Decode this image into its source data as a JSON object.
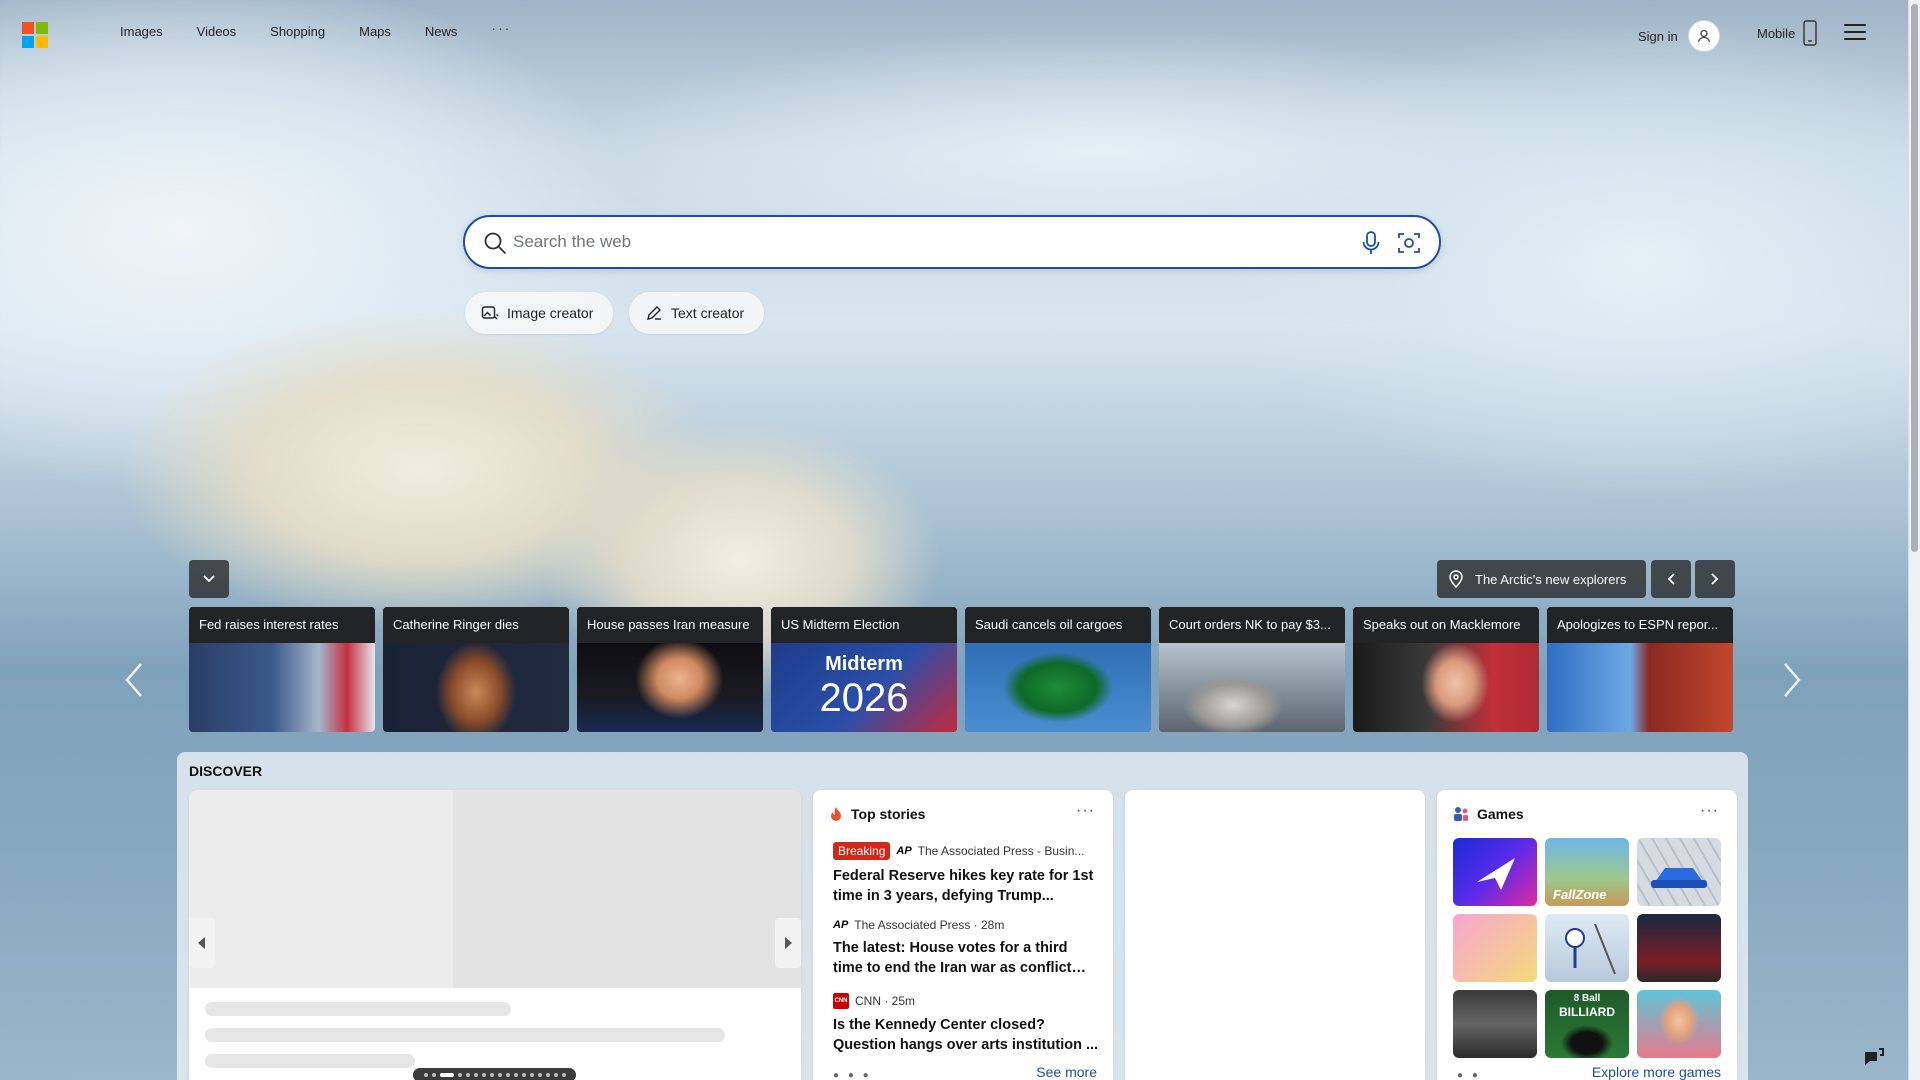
{
  "nav": {
    "items": [
      "Images",
      "Videos",
      "Shopping",
      "Maps",
      "News"
    ],
    "more": "···",
    "signin": "Sign in",
    "mobile": "Mobile"
  },
  "brand_colors": {
    "red": "#f25022",
    "green": "#7fba00",
    "blue": "#00a4ef",
    "yellow": "#ffb900",
    "accent": "#1a4fa3"
  },
  "search": {
    "placeholder": "Search the web",
    "value": ""
  },
  "actions": {
    "image_creator": "Image creator",
    "text_creator": "Text creator"
  },
  "image_info": {
    "title": "The Arctic's new explorers"
  },
  "trending": [
    {
      "title": "Fed raises interest rates"
    },
    {
      "title": "Catherine Ringer dies"
    },
    {
      "title": "House passes Iran measure"
    },
    {
      "title": "US Midterm Election",
      "overlay_line1": "Midterm",
      "overlay_line2": "2026"
    },
    {
      "title": "Saudi cancels oil cargoes"
    },
    {
      "title": "Court orders NK to pay $3..."
    },
    {
      "title": "Speaks out on Macklemore"
    },
    {
      "title": "Apologizes to ESPN repor..."
    }
  ],
  "discover": {
    "heading": "DISCOVER",
    "top_stories": {
      "title": "Top stories",
      "more": "···",
      "see_more": "See more",
      "stories": [
        {
          "badge": "Breaking",
          "source": "The Associated Press - Busin...",
          "headline": "Federal Reserve hikes key rate for 1st time in 3 years, defying Trump..."
        },
        {
          "source": "The Associated Press · 28m",
          "headline": "The latest: House votes for a third time to end the Iran war as conflict drags..."
        },
        {
          "source": "CNN · 25m",
          "headline": "Is the Kennedy Center closed? Question hangs over arts institution ..."
        }
      ]
    },
    "games": {
      "title": "Games",
      "more": "···",
      "explore": "Explore more games",
      "tile_labels": [
        "FallZone",
        "8 Ball",
        "BILLIARD"
      ]
    }
  }
}
